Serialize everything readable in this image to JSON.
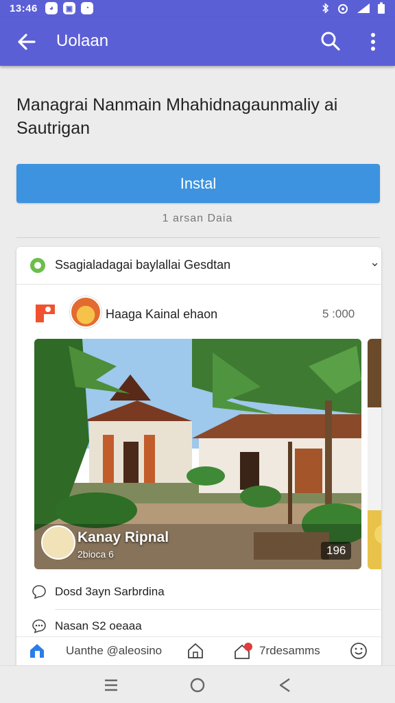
{
  "status_bar": {
    "time": "13:46",
    "left_icons": [
      "wechat-icon",
      "gallery-icon",
      "message-icon"
    ],
    "right_icons": [
      "bluetooth-icon",
      "wifi-icon",
      "signal-icon",
      "battery-icon"
    ]
  },
  "app_bar": {
    "title": "Uolaan",
    "back_icon": "arrow-left-icon",
    "search_icon": "search-icon",
    "more_icon": "more-vertical-icon",
    "color": "#5b5fd6"
  },
  "page": {
    "title": "Managrai Nanmain Mhahidnagaunmaliy  ai Sautrigan",
    "install_label": "Instal",
    "install_color": "#3d93df",
    "install_sub": "1 arsan Daia"
  },
  "card": {
    "group_title": "Ssagialadagai baylallai Gesdtan",
    "post": {
      "author": "Haaga Kainal ehaon",
      "time": "5 :000",
      "photo_caption": "Kanay Ripnal",
      "photo_sub": "2bioca 6",
      "photo_count": "196"
    },
    "actions": [
      {
        "label": "Dosd 3ayn Sarbrdina",
        "icon": "comment-icon"
      },
      {
        "label": "Nasan   S2 oeaaa",
        "icon": "chat-icon"
      }
    ]
  },
  "bottom_tabs": [
    {
      "label": "Uanthe @aleosino",
      "icon": "home-filled-icon"
    },
    {
      "label": "",
      "icon": "house-outline-icon"
    },
    {
      "label": "7rdesamms",
      "icon": "notification-icon"
    },
    {
      "label": "",
      "icon": "smiley-icon"
    }
  ],
  "nav_bar": {
    "icons": [
      "recents-icon",
      "home-circle-icon",
      "back-triangle-icon"
    ]
  }
}
